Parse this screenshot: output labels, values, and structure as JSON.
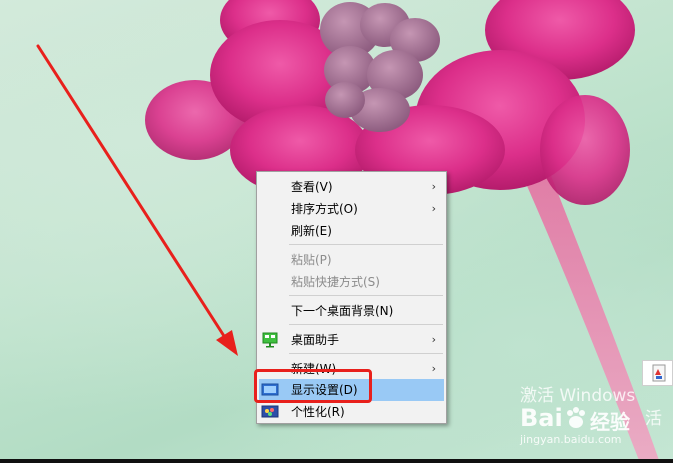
{
  "context_menu": {
    "items": [
      {
        "label": "查看(V)",
        "submenu": true,
        "icon": "none"
      },
      {
        "label": "排序方式(O)",
        "submenu": true,
        "icon": "none"
      },
      {
        "label": "刷新(E)",
        "submenu": false,
        "icon": "none"
      },
      {
        "label": "粘贴(P)",
        "submenu": false,
        "disabled": true,
        "icon": "none"
      },
      {
        "label": "粘贴快捷方式(S)",
        "submenu": false,
        "disabled": true,
        "icon": "none"
      },
      {
        "label": "下一个桌面背景(N)",
        "submenu": false,
        "icon": "none"
      },
      {
        "label": "桌面助手",
        "submenu": true,
        "icon": "desktop-assistant-icon"
      },
      {
        "label": "新建(W)",
        "submenu": true,
        "icon": "none"
      },
      {
        "label": "显示设置(D)",
        "submenu": false,
        "highlighted": true,
        "icon": "display-settings-icon"
      },
      {
        "label": "个性化(R)",
        "submenu": false,
        "icon": "personalize-icon"
      }
    ],
    "chevron": "›"
  },
  "watermark": {
    "activate_text": "激活 Windows",
    "brand": "Bai",
    "brand_suffix": "经验",
    "url": "jingyan.baidu.com",
    "tail_text": "活"
  },
  "colors": {
    "highlight": "#99c9f5",
    "annotation_red": "#e8201c",
    "menu_bg": "#f2f2f2"
  }
}
